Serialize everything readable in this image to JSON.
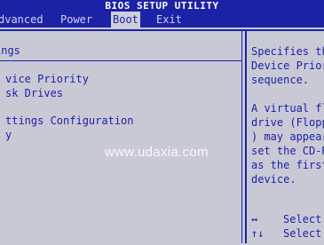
{
  "title": "BIOS SETUP UTILITY",
  "menu": [
    {
      "label": "dvanced",
      "active": false
    },
    {
      "label": "Power",
      "active": false
    },
    {
      "label": "Boot",
      "active": true
    },
    {
      "label": "Exit",
      "active": false
    }
  ],
  "section_title": "ings",
  "items": [
    "vice Priority",
    "sk Drives",
    "ttings Configuration",
    "y"
  ],
  "help_text": "Specifies the\nDevice Priori\nsequence.\n\nA virtual flo\ndrive (Floppy\n) may appear\nset the CD-RO\nas the first\ndevice.",
  "keys": [
    {
      "key": "↔",
      "action": "Select"
    },
    {
      "key": "↑↓",
      "action": "Select"
    }
  ],
  "watermark": "www.udaxia.com",
  "colors": {
    "bios_blue": "#1c22a6",
    "bios_gray": "#c9c9d6"
  }
}
